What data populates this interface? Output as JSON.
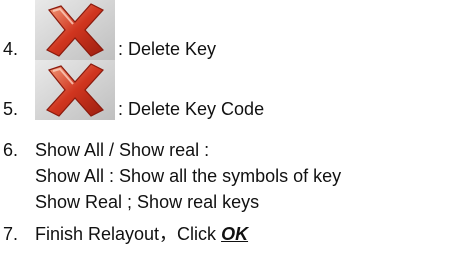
{
  "items": [
    {
      "number": "4.",
      "icon": "red-x-delete-icon",
      "label": ": Delete Key"
    },
    {
      "number": "5.",
      "icon": "red-x-delete-icon",
      "label": ": Delete Key Code"
    },
    {
      "number": "6.",
      "label": "Show All / Show real :",
      "sub_lines": [
        "Show All : Show all the symbols of key",
        "Show Real ; Show real keys"
      ]
    },
    {
      "number": "7.",
      "label": "Finish Relayout，Click ",
      "emphasis": "OK"
    }
  ],
  "colors": {
    "text": "#111111",
    "icon_red": "#d0351f",
    "icon_red_dark": "#9c1f10",
    "icon_red_light": "#f0886c",
    "icon_bg": "#d2d2d2"
  }
}
